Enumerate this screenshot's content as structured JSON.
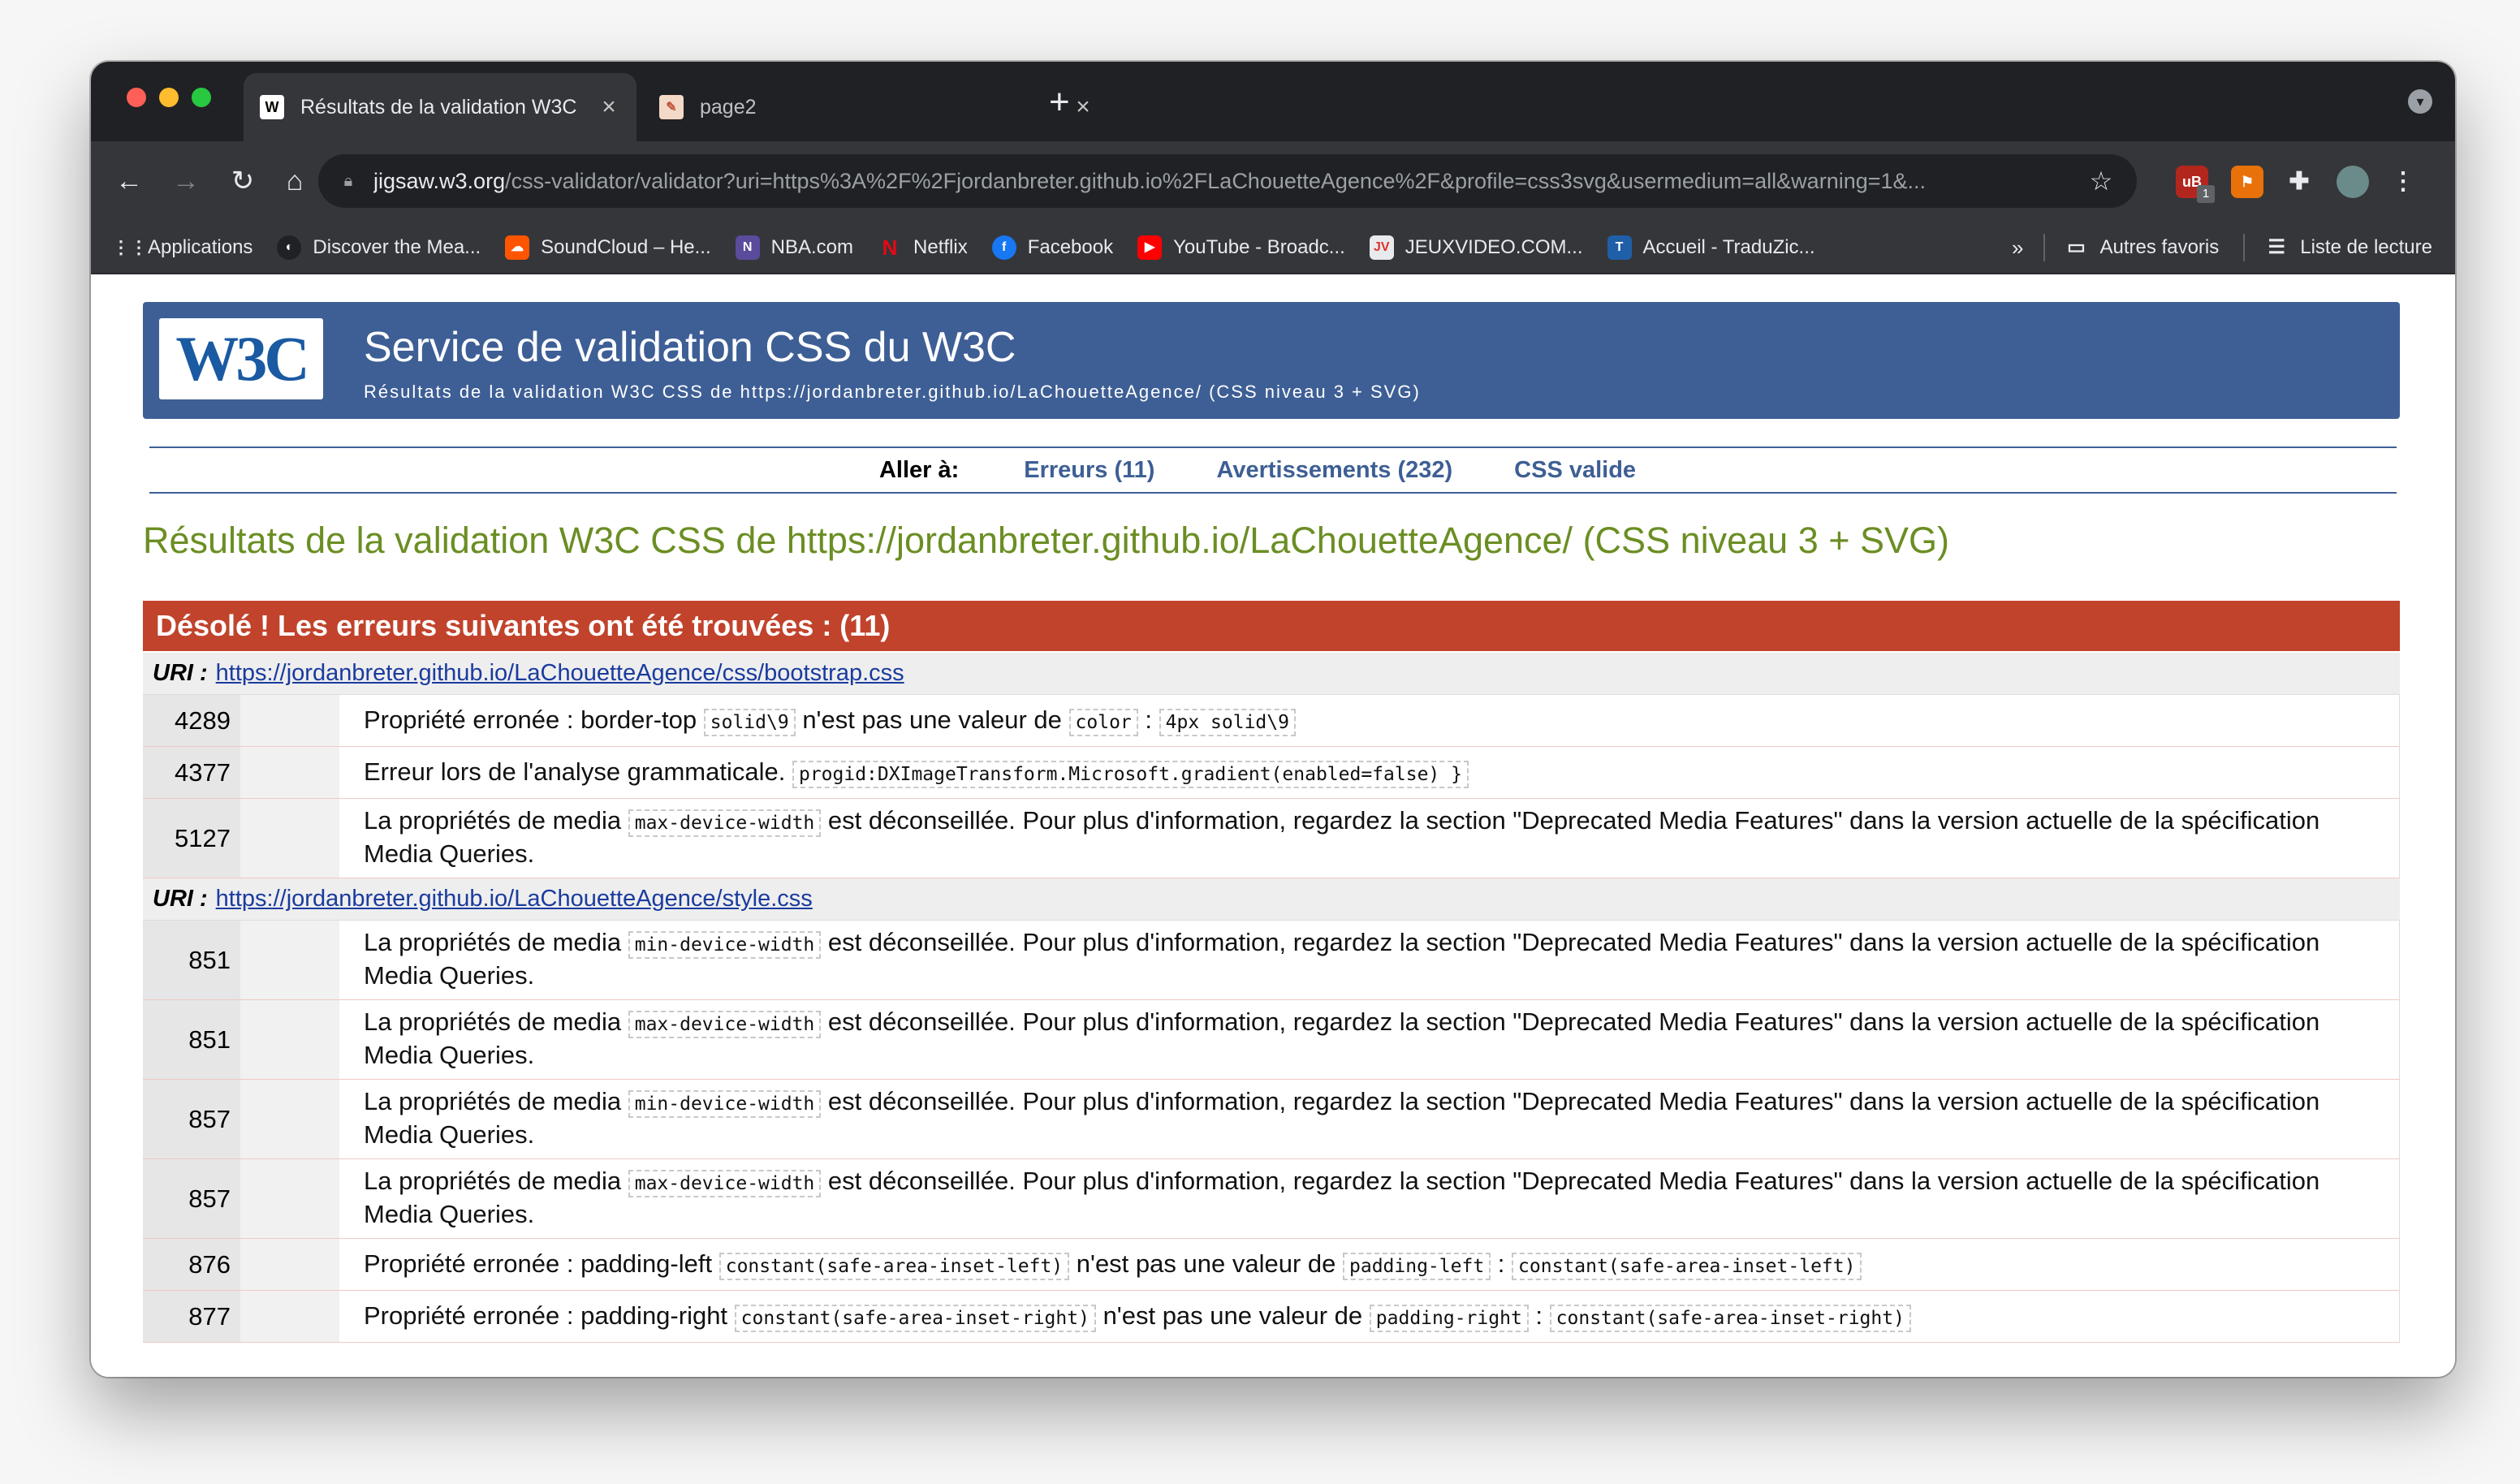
{
  "browser": {
    "tabs": [
      {
        "title": "Résultats de la validation W3C",
        "favicon": "W3C",
        "active": true
      },
      {
        "title": "page2",
        "favicon": "✎",
        "active": false
      }
    ],
    "url_host": "jigsaw.w3.org",
    "url_rest": "/css-validator/validator?uri=https%3A%2F%2Fjordanbreter.github.io%2FLaChouetteAgence%2F&profile=css3svg&usermedium=all&warning=1&...",
    "extension_badge": "1",
    "bookmarks": [
      {
        "label": "Applications",
        "icon": "apps-grid-icon"
      },
      {
        "label": "Discover the Mea...",
        "icon": "moon-icon"
      },
      {
        "label": "SoundCloud – He...",
        "icon": "soundcloud-icon"
      },
      {
        "label": "NBA.com",
        "icon": "nba-icon"
      },
      {
        "label": "Netflix",
        "icon": "netflix-icon"
      },
      {
        "label": "Facebook",
        "icon": "facebook-icon"
      },
      {
        "label": "YouTube - Broadc...",
        "icon": "youtube-icon"
      },
      {
        "label": "JEUXVIDEO.COM...",
        "icon": "jv-icon"
      },
      {
        "label": "Accueil - TraduZic...",
        "icon": "traduzic-icon"
      }
    ],
    "more": "»",
    "other_bookmarks": "Autres favoris",
    "reading_list": "Liste de lecture"
  },
  "validator": {
    "logo": "W3C",
    "title": "Service de validation CSS du W3C",
    "subtitle": "Résultats de la validation W3C CSS de https://jordanbreter.github.io/LaChouetteAgence/ (CSS niveau 3 + SVG)",
    "jump_label": "Aller à:",
    "jump_errors": "Erreurs (11)",
    "jump_warnings": "Avertissements (232)",
    "jump_valid": "CSS valide",
    "results_title": "Résultats de la validation W3C CSS de https://jordanbreter.github.io/LaChouetteAgence/ (CSS niveau 3 + SVG)",
    "error_header": "Désolé ! Les erreurs suivantes ont été trouvées : (11)",
    "uri_label": "URI :",
    "uri1": "https://jordanbreter.github.io/LaChouetteAgence/css/bootstrap.css",
    "uri2": "https://jordanbreter.github.io/LaChouetteAgence/style.css",
    "text": {
      "bad_prop": "Propriété erronée : border-top",
      "not_value_of": "n'est pas une valeur de",
      "colon": ":",
      "parse_error": "Erreur lors de l'analyse grammaticale.",
      "media_prefix": "La propriétés de media",
      "media_suffix": "est déconseillée. Pour plus d'information, regardez la section \"Deprecated Media Features\" dans la version actuelle de la spécification Media Queries.",
      "bad_prop_pl": "Propriété erronée : padding-left",
      "bad_prop_pr": "Propriété erronée : padding-right"
    },
    "rows": {
      "r4289": {
        "line": "4289",
        "c1": "solid\\9",
        "c2": "color",
        "c3": "4px solid\\9"
      },
      "r4377": {
        "line": "4377",
        "c1": "progid:DXImageTransform.Microsoft.gradient(enabled=false) }"
      },
      "r5127": {
        "line": "5127",
        "c1": "max-device-width"
      },
      "r851a": {
        "line": "851",
        "c1": "min-device-width"
      },
      "r851b": {
        "line": "851",
        "c1": "max-device-width"
      },
      "r857a": {
        "line": "857",
        "c1": "min-device-width"
      },
      "r857b": {
        "line": "857",
        "c1": "max-device-width"
      },
      "r876": {
        "line": "876",
        "c1": "constant(safe-area-inset-left)",
        "c2": "padding-left",
        "c3": "constant(safe-area-inset-left)"
      },
      "r877": {
        "line": "877",
        "c1": "constant(safe-area-inset-right)",
        "c2": "padding-right",
        "c3": "constant(safe-area-inset-right)"
      }
    }
  },
  "colors": {
    "banner": "#3e5f95",
    "error_header": "#c1432c",
    "results_title": "#6b8e23",
    "link": "#1a3b9e"
  }
}
